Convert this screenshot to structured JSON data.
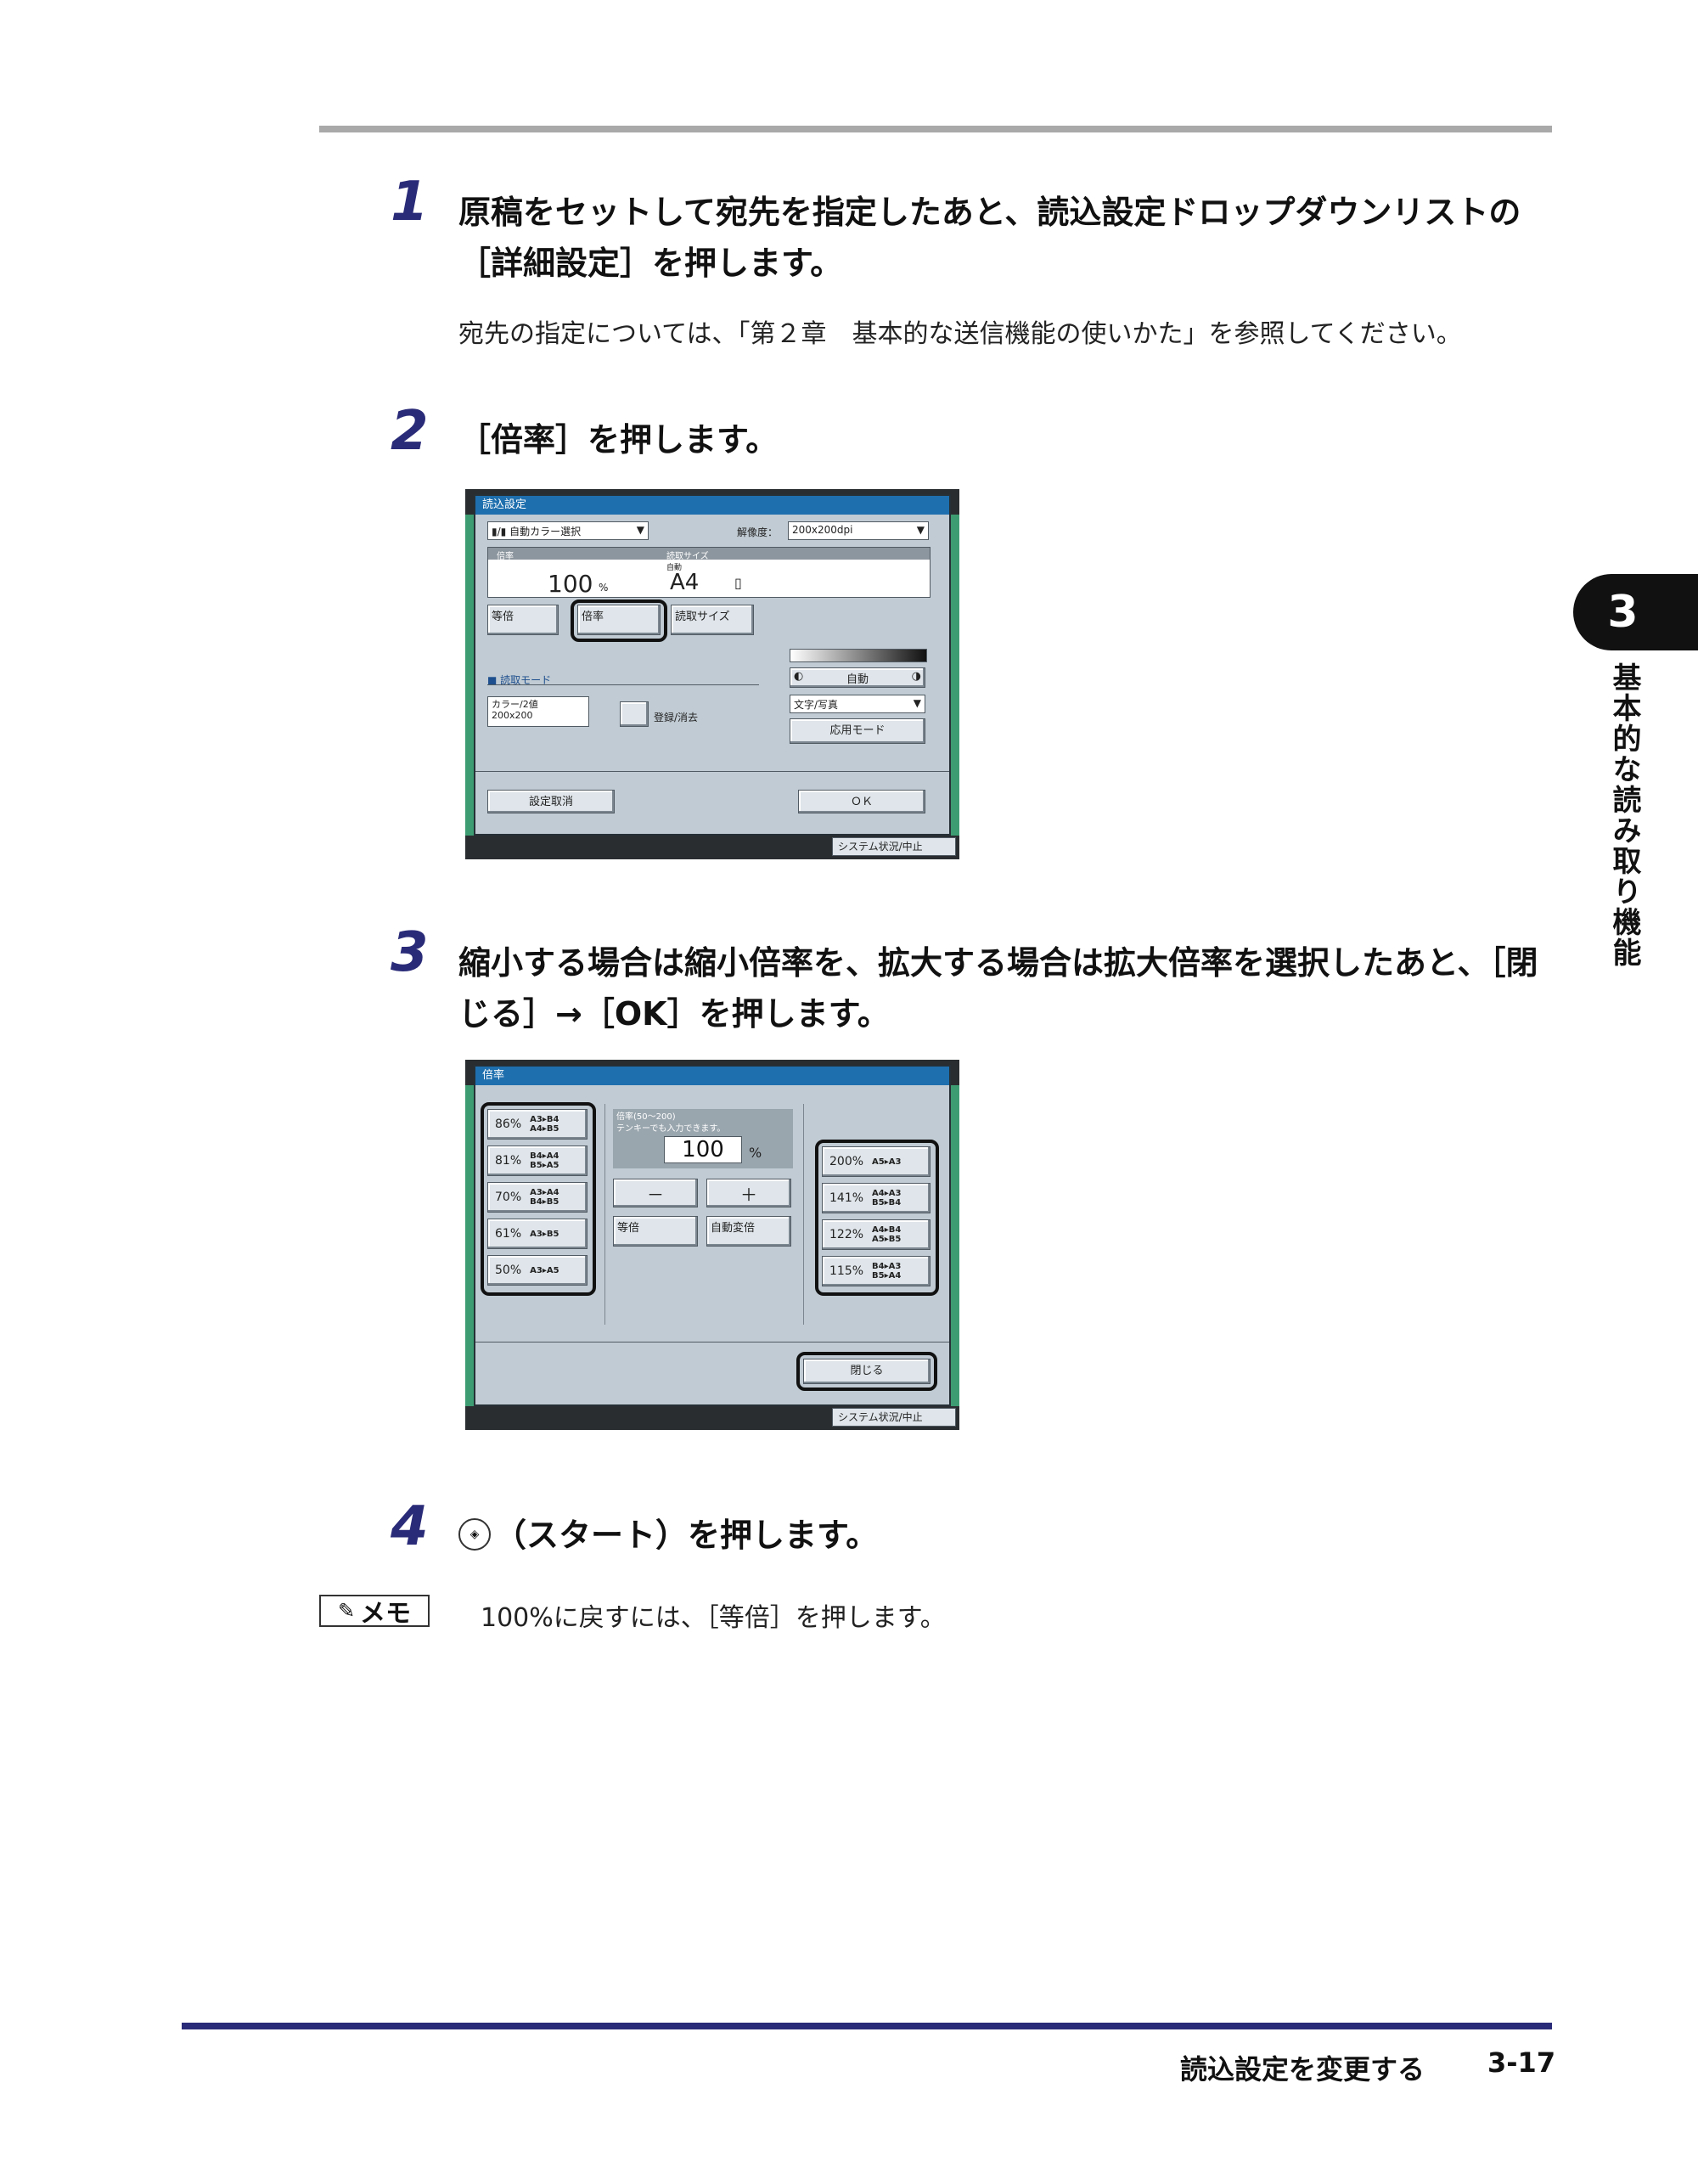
{
  "step1": {
    "num": "1",
    "text": "原稿をセットして宛先を指定したあと、読込設定ドロップダウンリストの［詳細設定］を押します。",
    "note": "宛先の指定については、「第２章　基本的な送信機能の使いかた」を参照してください。"
  },
  "step2": {
    "num": "2",
    "text": "［倍率］を押します。"
  },
  "step3": {
    "num": "3",
    "text": "縮小する場合は縮小倍率を、拡大する場合は拡大倍率を選択したあと、［閉じる］→［OK］を押します。"
  },
  "step4": {
    "num": "4",
    "text": "（スタート）を押します。"
  },
  "memo": {
    "label": "メモ",
    "text": "100%に戻すには、［等倍］を押します。"
  },
  "chapter": {
    "number": "3",
    "title": "基本的な読み取り機能"
  },
  "footer": {
    "section": "読込設定を変更する",
    "page": "3-17"
  },
  "screen1": {
    "title": "読込設定",
    "color_select": "自動カラー選択",
    "resolution_label": "解像度：",
    "resolution_value": "200x200dpi",
    "ratio_label": "倍率",
    "scan_size_label": "読取サイズ",
    "scan_size_auto": "自動",
    "ratio_value": "100",
    "ratio_unit": "%",
    "scan_size_value": "A4",
    "btn_same": "等倍",
    "btn_ratio": "倍率",
    "btn_scan_size": "読取サイズ",
    "scan_mode_label": "■ 読取モード",
    "mode_select_1": "カラー/2値",
    "mode_select_2": "200x200",
    "btn_register": "登録/消去",
    "density_auto": "自動",
    "text_photo": "文字/写真",
    "btn_advanced": "応用モード",
    "btn_cancel": "設定取消",
    "btn_ok": "ＯＫ",
    "status": "システム状況/中止"
  },
  "screen2": {
    "title": "倍率",
    "reduce": [
      {
        "pct": "86%",
        "l1": "A3▸B4",
        "l2": "A4▸B5"
      },
      {
        "pct": "81%",
        "l1": "B4▸A4",
        "l2": "B5▸A5"
      },
      {
        "pct": "70%",
        "l1": "A3▸A4",
        "l2": "B4▸B5"
      },
      {
        "pct": "61%",
        "l1": "A3▸B5",
        "l2": ""
      },
      {
        "pct": "50%",
        "l1": "A3▸A5",
        "l2": ""
      }
    ],
    "enlarge": [
      {
        "pct": "200%",
        "l1": "A5▸A3",
        "l2": ""
      },
      {
        "pct": "141%",
        "l1": "A4▸A3",
        "l2": "B5▸B4"
      },
      {
        "pct": "122%",
        "l1": "A4▸B4",
        "l2": "A5▸B5"
      },
      {
        "pct": "115%",
        "l1": "B4▸A3",
        "l2": "B5▸A4"
      }
    ],
    "ratio_range": "倍率(50～200)",
    "keypad_hint": "テンキーでも入力できます。",
    "value": "100",
    "unit": "%",
    "minus": "－",
    "plus": "＋",
    "btn_same": "等倍",
    "btn_auto": "自動変倍",
    "btn_close": "閉じる",
    "status": "システム状況/中止"
  }
}
